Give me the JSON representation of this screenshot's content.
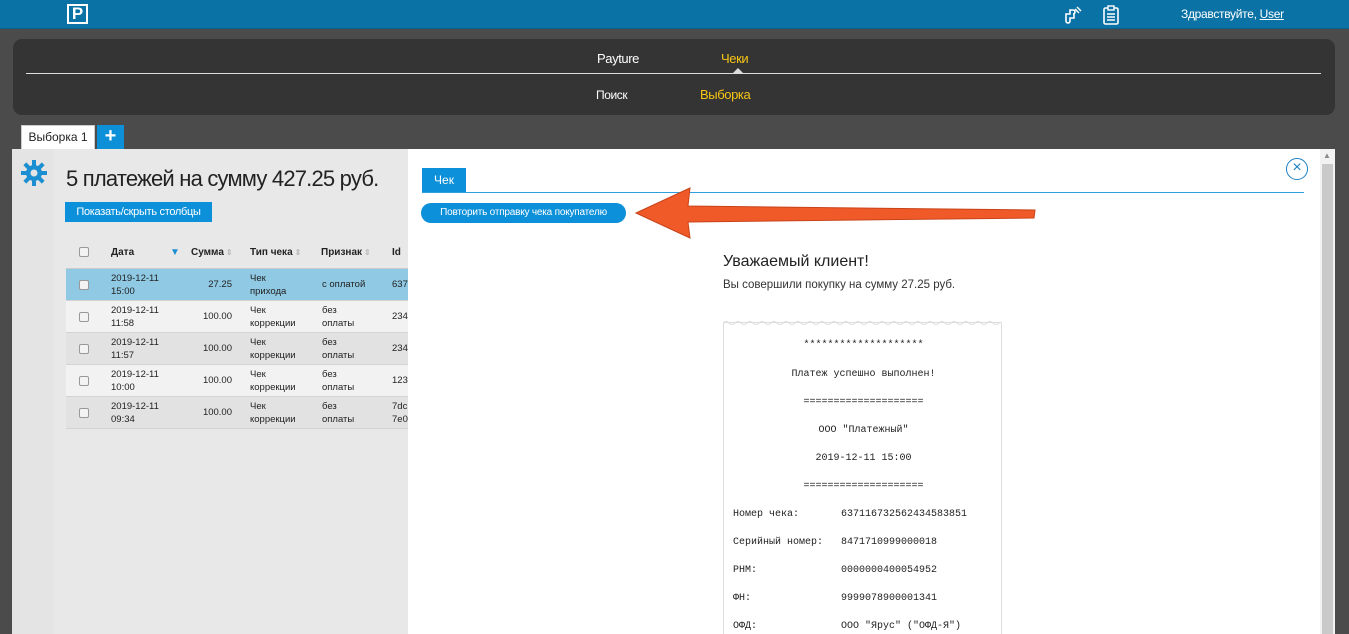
{
  "topbar": {
    "logo": "P",
    "greeting_prefix": "Здравствуйте, ",
    "user": "User",
    "icons": [
      "plugin-icon",
      "clipboard-icon"
    ]
  },
  "nav": {
    "payture": "Payture",
    "cheki": "Чеки",
    "poisk": "Поиск",
    "vyborka": "Выборка"
  },
  "tabs": {
    "first": "Выборка 1",
    "add": "+"
  },
  "left": {
    "summary": "5 платежей на сумму 427.25 руб.",
    "columns_button": "Показать/скрыть столбцы",
    "headers": [
      "Дата",
      "Сумма",
      "Тип чека",
      "Признак",
      "Id"
    ],
    "rows": [
      {
        "date": "2019-12-11",
        "time": "15:00",
        "amount": "27.25",
        "type1": "Чек",
        "type2": "прихода",
        "sign1": "с оплатой",
        "sign2": "",
        "id1": "637",
        "id2": ""
      },
      {
        "date": "2019-12-11",
        "time": "11:58",
        "amount": "100.00",
        "type1": "Чек",
        "type2": "коррекции",
        "sign1": "без",
        "sign2": "оплаты",
        "id1": "234",
        "id2": ""
      },
      {
        "date": "2019-12-11",
        "time": "11:57",
        "amount": "100.00",
        "type1": "Чек",
        "type2": "коррекции",
        "sign1": "без",
        "sign2": "оплаты",
        "id1": "234",
        "id2": ""
      },
      {
        "date": "2019-12-11",
        "time": "10:00",
        "amount": "100.00",
        "type1": "Чек",
        "type2": "коррекции",
        "sign1": "без",
        "sign2": "оплаты",
        "id1": "123",
        "id2": ""
      },
      {
        "date": "2019-12-11",
        "time": "09:34",
        "amount": "100.00",
        "type1": "Чек",
        "type2": "коррекции",
        "sign1": "без",
        "sign2": "оплаты",
        "id1": "7dc",
        "id2": "7e0"
      }
    ]
  },
  "right": {
    "tab": "Чек",
    "resend_button": "Повторить отправку чека покупателю",
    "greet_title": "Уважаемый клиент!",
    "greet_text": "Вы совершили покупку на сумму 27.25 руб.",
    "receipt": {
      "stars": "********************",
      "success": "Платеж успешно выполнен!",
      "eq": "====================",
      "company": "ООО \"Платежный\"",
      "datetime": "2019-12-11 15:00",
      "eq2": "====================",
      "rows": [
        {
          "k": "Номер чека:",
          "v": "637116732562434583851"
        },
        {
          "k": "Серийный номер:",
          "v": "8471710999000018"
        },
        {
          "k": "РНМ:",
          "v": "0000000400054952"
        },
        {
          "k": "ФН:",
          "v": "9999078900001341"
        },
        {
          "k": "ОФД:",
          "v": "ООО \"Ярус\" (\"ОФД-Я\")"
        }
      ]
    }
  },
  "colors": {
    "topbar": "#0b72a6",
    "accent": "#0b90d9",
    "active_nav": "#f6c514",
    "selected_row": "#8fc9e3",
    "arrow": "#f05a28"
  }
}
